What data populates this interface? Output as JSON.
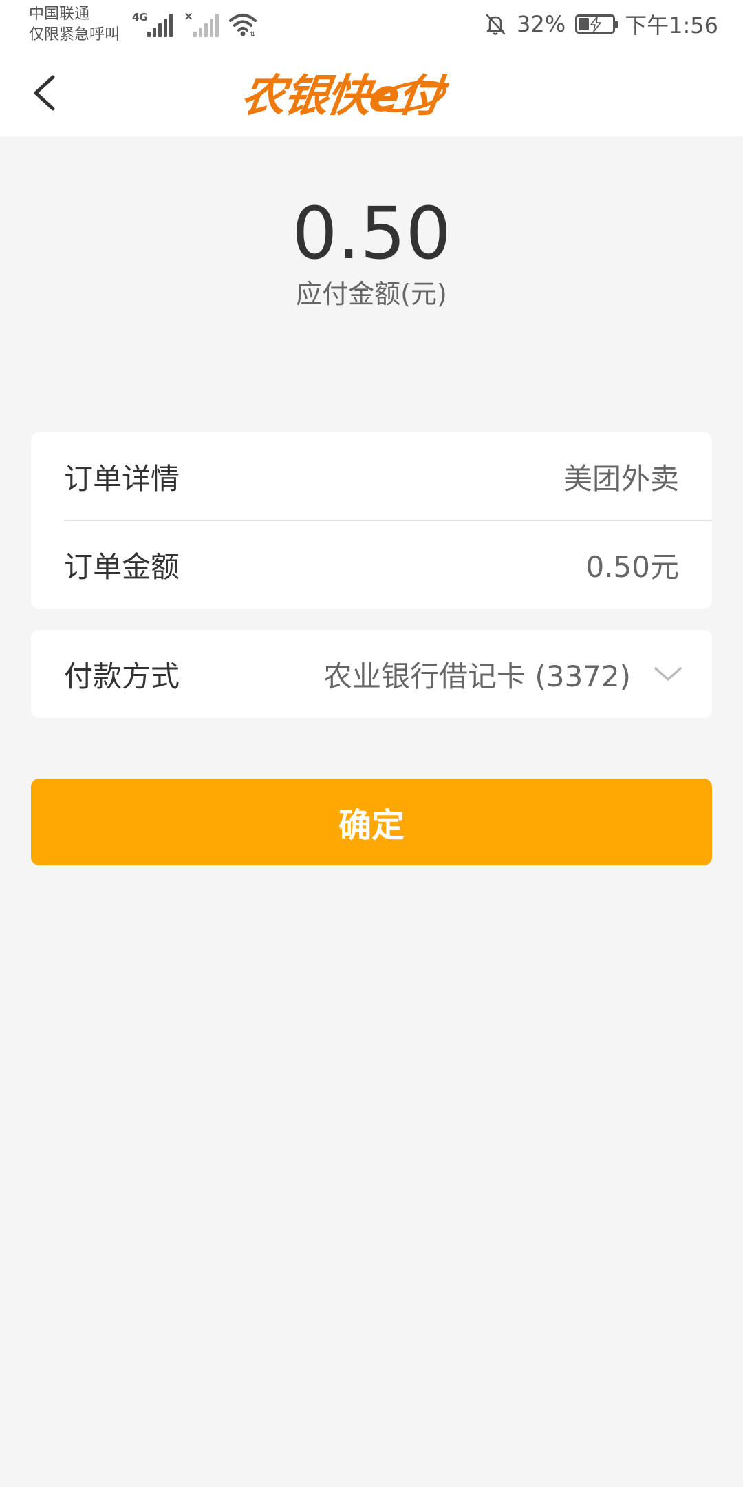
{
  "status_bar": {
    "carrier_line1": "中国联通",
    "carrier_line2": "仅限紧急呼叫",
    "network_type": "4G",
    "battery_percent": "32%",
    "battery_level": 0.32,
    "time": "下午1:56"
  },
  "header": {
    "logo_text": "农银快e付"
  },
  "payment": {
    "amount": "0.50",
    "amount_label": "应付金额(元)"
  },
  "order": {
    "detail_label": "订单详情",
    "detail_value": "美团外卖",
    "amount_label": "订单金额",
    "amount_value": "0.50元"
  },
  "method": {
    "label": "付款方式",
    "value": "农业银行借记卡 (3372)"
  },
  "confirm_label": "确定",
  "colors": {
    "brand_orange": "#ee7a0e",
    "button": "#ffa702",
    "background": "#f5f5f5"
  }
}
